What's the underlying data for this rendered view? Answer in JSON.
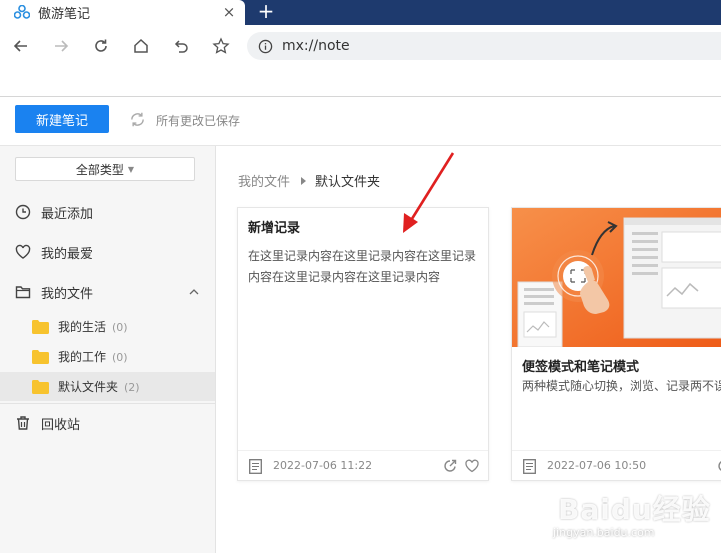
{
  "browser": {
    "tab_title": "傲游笔记",
    "tab_close": "×",
    "new_tab": "+",
    "url": "mx://note"
  },
  "header": {
    "new_note_label": "新建笔记",
    "save_status": "所有更改已保存"
  },
  "sidebar": {
    "type_filter": "全部类型",
    "recent": "最近添加",
    "favorites": "我的最爱",
    "my_files": "我的文件",
    "folders": [
      {
        "label": "我的生活",
        "count": "(0)"
      },
      {
        "label": "我的工作",
        "count": "(0)"
      },
      {
        "label": "默认文件夹",
        "count": "(2)"
      }
    ],
    "trash": "回收站"
  },
  "breadcrumb": {
    "root": "我的文件",
    "current": "默认文件夹"
  },
  "notes": [
    {
      "title": "新增记录",
      "body": "在这里记录内容在这里记录内容在这里记录内容在这里记录内容在这里记录内容",
      "date": "2022-07-06 11:22"
    },
    {
      "title": "便签模式和笔记模式",
      "body": "两种模式随心切换，浏览、记录两不误",
      "date": "2022-07-06 10:50"
    }
  ],
  "watermark": {
    "text": "Baidu经验",
    "sub": "jingyan.baidu.com"
  },
  "colors": {
    "accent": "#1a82f0",
    "tabstrip": "#1e3a6e",
    "annotation_arrow": "#e02020",
    "thumb_orange": "#f26b1d"
  }
}
